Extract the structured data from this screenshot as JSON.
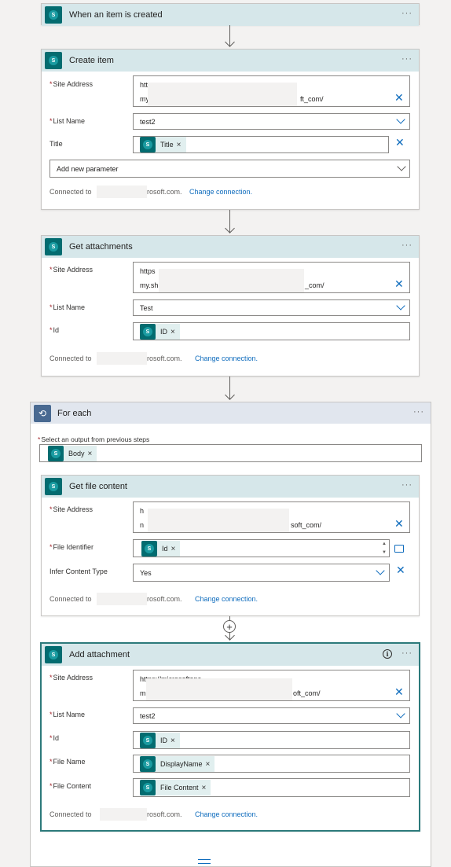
{
  "trigger": {
    "title": "When an item is created"
  },
  "create_item": {
    "title": "Create item",
    "site_address_label": "Site Address",
    "site_address_line1": "http",
    "site_address_line2_start": "my.",
    "site_address_line2_end": "ft_com/",
    "list_name_label": "List Name",
    "list_name_value": "test2",
    "title_label": "Title",
    "title_token": "Title",
    "add_param": "Add new parameter",
    "connected_to": "Connected to",
    "connected_domain": "rosoft.com.",
    "change_connection": "Change connection."
  },
  "get_attachments": {
    "title": "Get attachments",
    "site_address_label": "Site Address",
    "site_address_line1": "https",
    "site_address_line2_start": "my.sh",
    "site_address_line2_end": "_com/",
    "list_name_label": "List Name",
    "list_name_value": "Test",
    "id_label": "Id",
    "id_token": "ID",
    "connected_to": "Connected to",
    "connected_domain": "rosoft.com.",
    "change_connection": "Change connection."
  },
  "for_each": {
    "title": "For each",
    "select_label": "Select an output from previous steps",
    "body_token": "Body"
  },
  "get_file_content": {
    "title": "Get file content",
    "site_address_label": "Site Address",
    "site_address_line1": "h",
    "site_address_line2_start": "n",
    "site_address_line2_end": "soft_com/",
    "file_id_label": "File Identifier",
    "file_id_token": "Id",
    "infer_label": "Infer Content Type",
    "infer_value": "Yes",
    "connected_to": "Connected to",
    "connected_domain": "rosoft.com.",
    "change_connection": "Change connection."
  },
  "add_attachment": {
    "title": "Add attachment",
    "site_address_label": "Site Address",
    "site_address_line1": "https://microsoftapc",
    "site_address_line2_start": "m",
    "site_address_line2_end": "oft_com/",
    "list_name_label": "List Name",
    "list_name_value": "test2",
    "id_label": "Id",
    "id_token": "ID",
    "file_name_label": "File Name",
    "file_name_token": "DisplayName",
    "file_content_label": "File Content",
    "file_content_token": "File Content",
    "connected_to": "Connected to",
    "connected_domain": "rosoft.com.",
    "change_connection": "Change connection."
  },
  "icons": {
    "sharepoint": "sharepoint-icon",
    "loop": "loop-icon",
    "more": "more-options-icon",
    "info": "info-icon",
    "clear": "clear-icon",
    "dropdown": "chevron-down-icon",
    "add": "plus-icon",
    "folder": "folder-icon"
  },
  "colors": {
    "sharepoint_brand": "#036c70",
    "card_header": "#d6e7ea",
    "loop_header": "#e1e6ee",
    "link": "#0f6cbd",
    "required": "#a4262c"
  }
}
